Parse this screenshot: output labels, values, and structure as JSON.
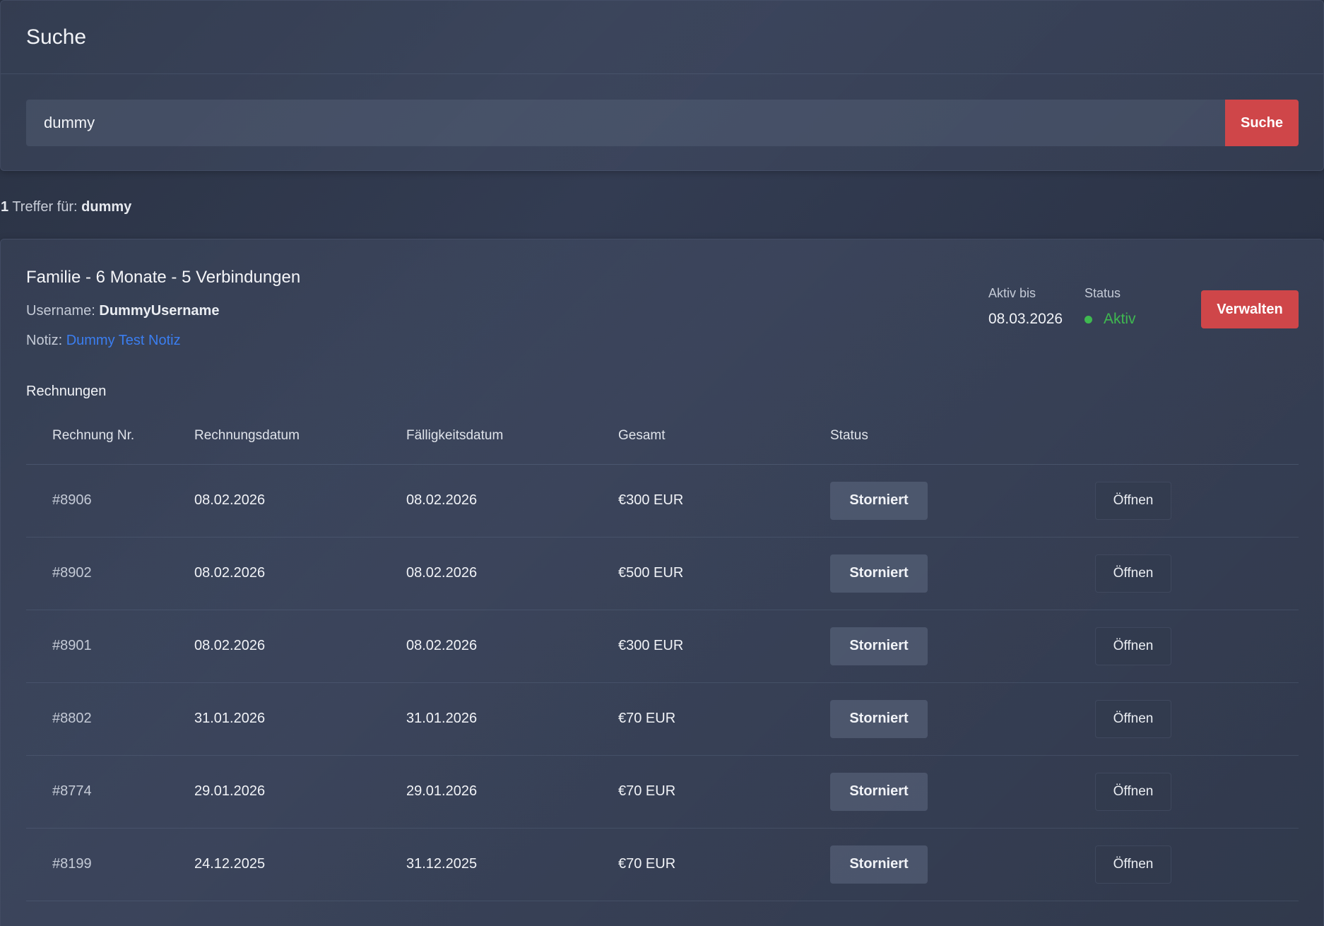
{
  "search_panel": {
    "title": "Suche",
    "query": "dummy",
    "button_label": "Suche"
  },
  "results": {
    "count": "1",
    "label": "Treffer für:",
    "term": "dummy"
  },
  "card": {
    "plan_title": "Familie - 6 Monate - 5 Verbindungen",
    "username_label": "Username:",
    "username": "DummyUsername",
    "note_label": "Notiz:",
    "note": "Dummy Test Notiz",
    "active_until_label": "Aktiv bis",
    "active_until": "08.03.2026",
    "status_label": "Status",
    "status": "Aktiv",
    "status_color": "#3fb950",
    "manage_label": "Verwalten",
    "accent_color": "#cf4649"
  },
  "invoices": {
    "title": "Rechnungen",
    "columns": [
      "Rechnung Nr.",
      "Rechnungsdatum",
      "Fälligkeitsdatum",
      "Gesamt",
      "Status"
    ],
    "rows": [
      {
        "number": "#8906",
        "invoice_date": "08.02.2026",
        "due_date": "08.02.2026",
        "total": "€300 EUR",
        "status": "Storniert",
        "action": "Öffnen"
      },
      {
        "number": "#8902",
        "invoice_date": "08.02.2026",
        "due_date": "08.02.2026",
        "total": "€500 EUR",
        "status": "Storniert",
        "action": "Öffnen"
      },
      {
        "number": "#8901",
        "invoice_date": "08.02.2026",
        "due_date": "08.02.2026",
        "total": "€300 EUR",
        "status": "Storniert",
        "action": "Öffnen"
      },
      {
        "number": "#8802",
        "invoice_date": "31.01.2026",
        "due_date": "31.01.2026",
        "total": "€70 EUR",
        "status": "Storniert",
        "action": "Öffnen"
      },
      {
        "number": "#8774",
        "invoice_date": "29.01.2026",
        "due_date": "29.01.2026",
        "total": "€70 EUR",
        "status": "Storniert",
        "action": "Öffnen"
      },
      {
        "number": "#8199",
        "invoice_date": "24.12.2025",
        "due_date": "31.12.2025",
        "total": "€70 EUR",
        "status": "Storniert",
        "action": "Öffnen"
      }
    ]
  }
}
